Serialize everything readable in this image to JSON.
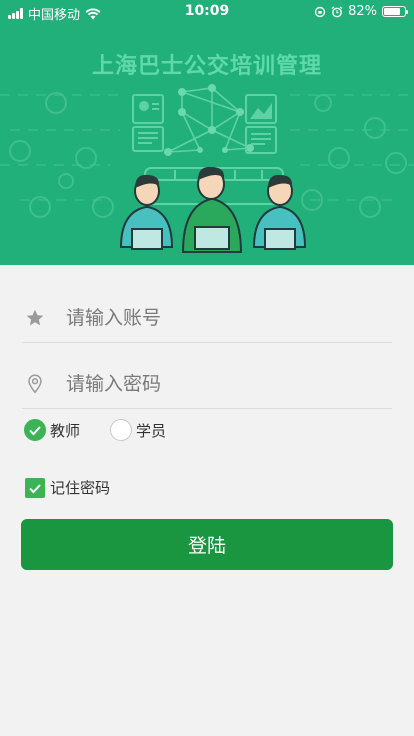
{
  "status_bar": {
    "carrier": "中国移动",
    "time": "10:09",
    "battery_percent": "82%",
    "battery_level": 0.82
  },
  "banner": {
    "title": "上海巴士公交培训管理",
    "background_color": "#22b07a",
    "illustration": "three-people-with-laptops-network-bus"
  },
  "login_form": {
    "account_placeholder": "请输入账号",
    "password_placeholder": "请输入密码",
    "account_icon": "star-icon",
    "password_icon": "location-pin-icon",
    "roles": [
      {
        "label": "教师",
        "checked": true
      },
      {
        "label": "学员",
        "checked": false
      }
    ],
    "remember_label": "记住密码",
    "remember_checked": true,
    "login_label": "登陆",
    "accent_color": "#1a9641"
  }
}
